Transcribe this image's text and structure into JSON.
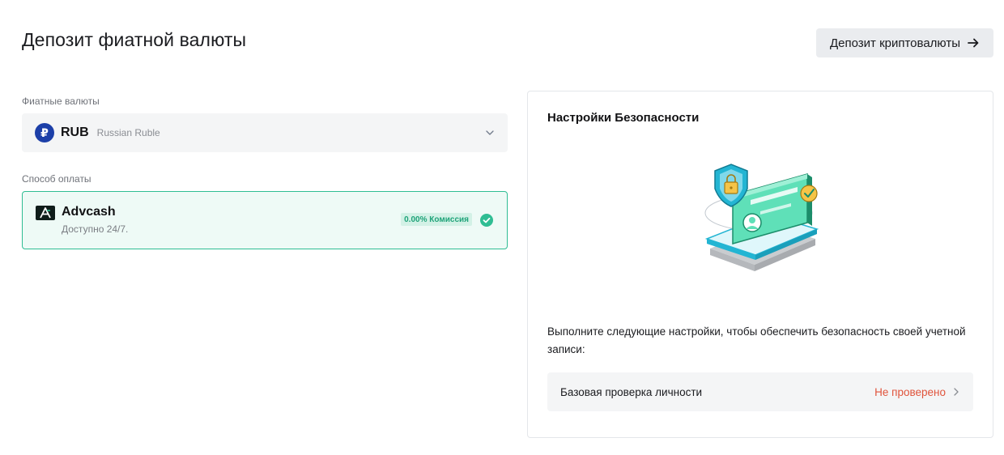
{
  "page": {
    "title": "Депозит фиатной валюты",
    "crypto_button": "Депозит криптовалюты"
  },
  "fiat": {
    "label": "Фиатные валюты",
    "selected_code": "RUB",
    "selected_name": "Russian Ruble",
    "icon_symbol": "₽"
  },
  "payment": {
    "label": "Способ оплаты",
    "method_name": "Advcash",
    "method_subtitle": "Доступно 24/7.",
    "fee_badge": "0.00% Комиссия"
  },
  "security": {
    "title": "Настройки Безопасности",
    "description": "Выполните следующие настройки, чтобы обеспечить безопасность своей учетной записи:",
    "items": [
      {
        "label": "Базовая проверка личности",
        "status": "Не проверено"
      }
    ]
  },
  "colors": {
    "accent_green": "#2fbd93",
    "status_red": "#e0543c",
    "ruble_blue": "#1c3fa8"
  },
  "icons": [
    "arrow-right-icon",
    "ruble-icon",
    "chevron-down-icon",
    "advcash-logo",
    "check-circle-icon",
    "security-illustration",
    "chevron-right-icon"
  ]
}
